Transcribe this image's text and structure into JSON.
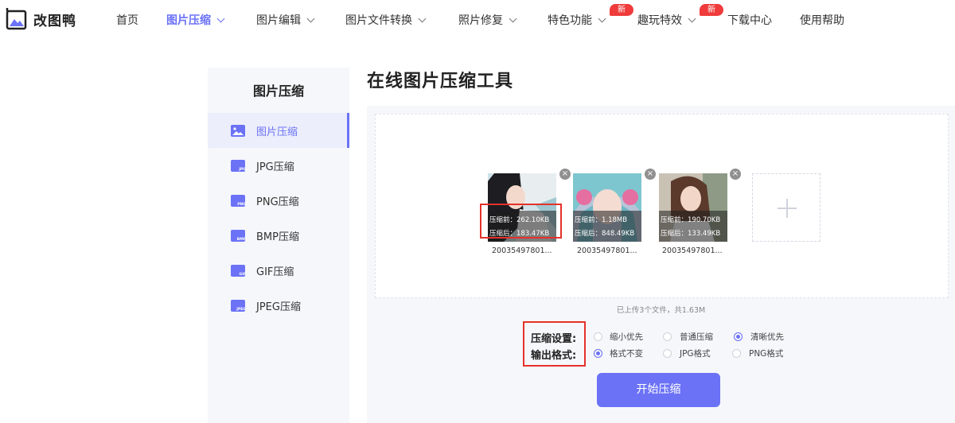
{
  "brand": {
    "name": "改图鸭"
  },
  "nav": {
    "items": [
      {
        "label": "首页"
      },
      {
        "label": "图片压缩"
      },
      {
        "label": "图片编辑"
      },
      {
        "label": "图片文件转换"
      },
      {
        "label": "照片修复"
      },
      {
        "label": "特色功能",
        "badge": "新"
      },
      {
        "label": "趣玩特效",
        "badge": "新"
      },
      {
        "label": "下载中心"
      },
      {
        "label": "使用帮助"
      }
    ]
  },
  "sidebar": {
    "title": "图片压缩",
    "items": [
      {
        "label": "图片压缩",
        "icon": "image-icon"
      },
      {
        "label": "JPG压缩",
        "icon": "jpg-file-icon",
        "tag": "JPG"
      },
      {
        "label": "PNG压缩",
        "icon": "png-file-icon",
        "tag": "PNG"
      },
      {
        "label": "BMP压缩",
        "icon": "bmp-file-icon",
        "tag": "BMP"
      },
      {
        "label": "GIF压缩",
        "icon": "gif-file-icon",
        "tag": "GIF"
      },
      {
        "label": "JPEG压缩",
        "icon": "jpeg-file-icon",
        "tag": "JPEG"
      }
    ]
  },
  "main": {
    "title": "在线图片压缩工具",
    "files": [
      {
        "before": "压缩前：262.10KB",
        "after": "压缩后：183.47KB",
        "name": "20035497801..."
      },
      {
        "before": "压缩前：1.18MB",
        "after": "压缩后：848.49KB",
        "name": "20035497801..."
      },
      {
        "before": "压缩前：190.70KB",
        "after": "压缩后：133.49KB",
        "name": "20035497801..."
      }
    ],
    "upload_info": "已上传3个文件，共1.63M",
    "compress_label": "压缩设置:",
    "format_label": "输出格式:",
    "compress_options": [
      "缩小优先",
      "普通压缩",
      "清晰优先"
    ],
    "compress_selected": "清晰优先",
    "format_options": [
      "格式不变",
      "JPG格式",
      "PNG格式"
    ],
    "format_selected": "格式不变",
    "start_button": "开始压缩"
  },
  "colors": {
    "accent": "#6b72f6",
    "badge": "#ef3b3b",
    "highlight_box": "#e4322b"
  }
}
